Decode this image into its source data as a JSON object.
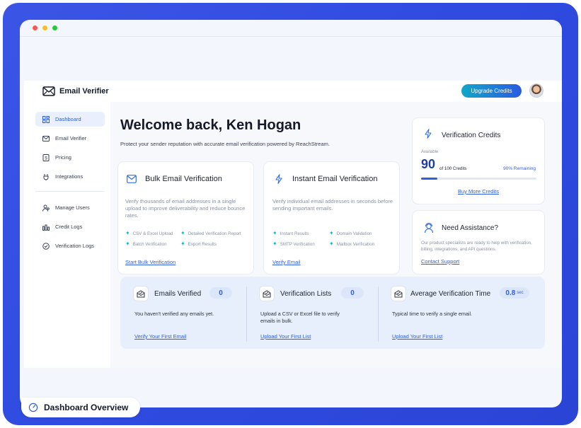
{
  "app": {
    "name": "Email Verifier",
    "upgrade_label": "Upgrade Credits"
  },
  "sidebar": {
    "items": [
      {
        "label": "Dashboard",
        "icon": "dashboard-icon",
        "active": true
      },
      {
        "label": "Email Verifier",
        "icon": "mail-icon"
      },
      {
        "label": "Pricing",
        "icon": "pricing-icon"
      },
      {
        "label": "Integrations",
        "icon": "integrations-icon"
      }
    ],
    "items2": [
      {
        "label": "Manage Users",
        "icon": "users-icon"
      },
      {
        "label": "Credit Logs",
        "icon": "bar-chart-icon"
      },
      {
        "label": "Verification Logs",
        "icon": "check-circle-icon"
      }
    ]
  },
  "main": {
    "welcome": "Welcome back, Ken Hogan",
    "subtitle": "Protect your sender reputation with accurate email verification powered by ReachStream."
  },
  "bulk": {
    "title": "Bulk Email Verification",
    "desc": "Verify thousands of email addresses in a single upload to improve deliverability and reduce bounce rates.",
    "features": [
      "CSV & Excel Upload",
      "Detailed Verification Report",
      "Batch Verification",
      "Export Results"
    ],
    "link": "Start Bulk Verification"
  },
  "instant": {
    "title": "Instant Email Verification",
    "desc": "Verify individual email addresses in seconds before sending important emails.",
    "features": [
      "Instant Results",
      "Domain Validation",
      "SMTP Verification",
      "Mailbox Verification"
    ],
    "link": "Verify Email"
  },
  "credits": {
    "title": "Verification Credits",
    "available_label": "Available",
    "value": "90",
    "of_label": "of 100 Credits",
    "remaining": "90% Remaining",
    "progress_percent": 14,
    "link": "Buy More Credits"
  },
  "assist": {
    "title": "Need Assistance?",
    "desc": "Our product specialists are ready to help with verification, billing, integrations, and API questions.",
    "link": "Contact Support"
  },
  "stats": [
    {
      "title": "Emails Verified",
      "value": "0",
      "unit": "",
      "desc": "You haven't verified any emails yet.",
      "link": "Verify Your First Email"
    },
    {
      "title": "Verification Lists",
      "value": "0",
      "unit": "",
      "desc": "Upload a CSV or Excel file to verify emails in bulk.",
      "link": "Upload Your First List"
    },
    {
      "title": "Average Verification Time",
      "value": "0.8",
      "unit": "sec",
      "desc": "Typical time to verify a single email.",
      "link": "Upload Your First List"
    }
  ],
  "badge": {
    "label": "Dashboard Overview"
  },
  "colors": {
    "accent": "#2f5fd9",
    "frame": "#3450e3",
    "teal": "#14b3c8"
  }
}
